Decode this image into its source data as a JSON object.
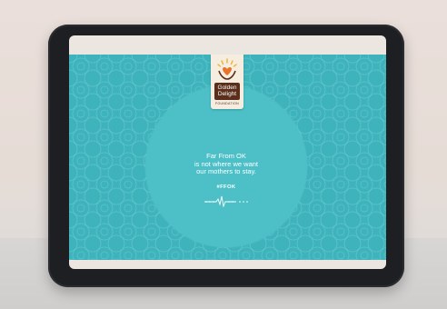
{
  "campaign": {
    "brand_line1": "Golden",
    "brand_line2": "Delight",
    "brand_sub": "FOUNDATION",
    "message_lines": [
      "Far From OK",
      "is not where we want",
      "our mothers to stay."
    ],
    "hashtag": "#FFOK"
  },
  "colors": {
    "banner": "#3fb3bb",
    "circle": "#4cbfc7",
    "brand_brown": "#5a2e1a",
    "heart": "#e8732c",
    "tablet_bezel": "#1e1f22"
  },
  "icons": [
    "sun-icon",
    "heart-icon",
    "hands-icon",
    "heartbeat-icon"
  ]
}
